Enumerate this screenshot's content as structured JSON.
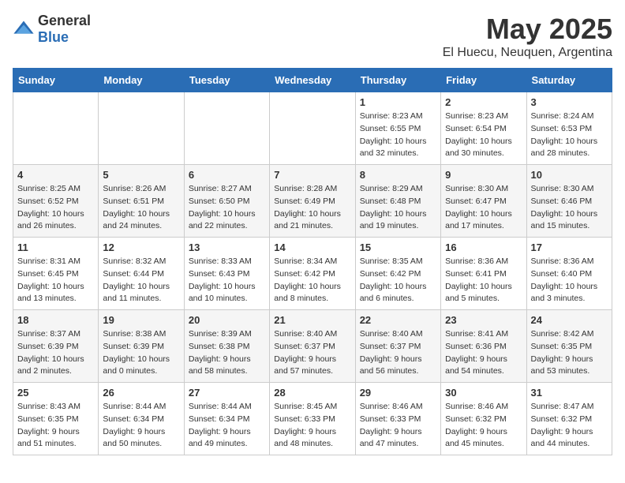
{
  "logo": {
    "text_general": "General",
    "text_blue": "Blue"
  },
  "title": "May 2025",
  "subtitle": "El Huecu, Neuquen, Argentina",
  "days_of_week": [
    "Sunday",
    "Monday",
    "Tuesday",
    "Wednesday",
    "Thursday",
    "Friday",
    "Saturday"
  ],
  "weeks": [
    [
      {
        "day": "",
        "info": ""
      },
      {
        "day": "",
        "info": ""
      },
      {
        "day": "",
        "info": ""
      },
      {
        "day": "",
        "info": ""
      },
      {
        "day": "1",
        "info": "Sunrise: 8:23 AM\nSunset: 6:55 PM\nDaylight: 10 hours\nand 32 minutes."
      },
      {
        "day": "2",
        "info": "Sunrise: 8:23 AM\nSunset: 6:54 PM\nDaylight: 10 hours\nand 30 minutes."
      },
      {
        "day": "3",
        "info": "Sunrise: 8:24 AM\nSunset: 6:53 PM\nDaylight: 10 hours\nand 28 minutes."
      }
    ],
    [
      {
        "day": "4",
        "info": "Sunrise: 8:25 AM\nSunset: 6:52 PM\nDaylight: 10 hours\nand 26 minutes."
      },
      {
        "day": "5",
        "info": "Sunrise: 8:26 AM\nSunset: 6:51 PM\nDaylight: 10 hours\nand 24 minutes."
      },
      {
        "day": "6",
        "info": "Sunrise: 8:27 AM\nSunset: 6:50 PM\nDaylight: 10 hours\nand 22 minutes."
      },
      {
        "day": "7",
        "info": "Sunrise: 8:28 AM\nSunset: 6:49 PM\nDaylight: 10 hours\nand 21 minutes."
      },
      {
        "day": "8",
        "info": "Sunrise: 8:29 AM\nSunset: 6:48 PM\nDaylight: 10 hours\nand 19 minutes."
      },
      {
        "day": "9",
        "info": "Sunrise: 8:30 AM\nSunset: 6:47 PM\nDaylight: 10 hours\nand 17 minutes."
      },
      {
        "day": "10",
        "info": "Sunrise: 8:30 AM\nSunset: 6:46 PM\nDaylight: 10 hours\nand 15 minutes."
      }
    ],
    [
      {
        "day": "11",
        "info": "Sunrise: 8:31 AM\nSunset: 6:45 PM\nDaylight: 10 hours\nand 13 minutes."
      },
      {
        "day": "12",
        "info": "Sunrise: 8:32 AM\nSunset: 6:44 PM\nDaylight: 10 hours\nand 11 minutes."
      },
      {
        "day": "13",
        "info": "Sunrise: 8:33 AM\nSunset: 6:43 PM\nDaylight: 10 hours\nand 10 minutes."
      },
      {
        "day": "14",
        "info": "Sunrise: 8:34 AM\nSunset: 6:42 PM\nDaylight: 10 hours\nand 8 minutes."
      },
      {
        "day": "15",
        "info": "Sunrise: 8:35 AM\nSunset: 6:42 PM\nDaylight: 10 hours\nand 6 minutes."
      },
      {
        "day": "16",
        "info": "Sunrise: 8:36 AM\nSunset: 6:41 PM\nDaylight: 10 hours\nand 5 minutes."
      },
      {
        "day": "17",
        "info": "Sunrise: 8:36 AM\nSunset: 6:40 PM\nDaylight: 10 hours\nand 3 minutes."
      }
    ],
    [
      {
        "day": "18",
        "info": "Sunrise: 8:37 AM\nSunset: 6:39 PM\nDaylight: 10 hours\nand 2 minutes."
      },
      {
        "day": "19",
        "info": "Sunrise: 8:38 AM\nSunset: 6:39 PM\nDaylight: 10 hours\nand 0 minutes."
      },
      {
        "day": "20",
        "info": "Sunrise: 8:39 AM\nSunset: 6:38 PM\nDaylight: 9 hours\nand 58 minutes."
      },
      {
        "day": "21",
        "info": "Sunrise: 8:40 AM\nSunset: 6:37 PM\nDaylight: 9 hours\nand 57 minutes."
      },
      {
        "day": "22",
        "info": "Sunrise: 8:40 AM\nSunset: 6:37 PM\nDaylight: 9 hours\nand 56 minutes."
      },
      {
        "day": "23",
        "info": "Sunrise: 8:41 AM\nSunset: 6:36 PM\nDaylight: 9 hours\nand 54 minutes."
      },
      {
        "day": "24",
        "info": "Sunrise: 8:42 AM\nSunset: 6:35 PM\nDaylight: 9 hours\nand 53 minutes."
      }
    ],
    [
      {
        "day": "25",
        "info": "Sunrise: 8:43 AM\nSunset: 6:35 PM\nDaylight: 9 hours\nand 51 minutes."
      },
      {
        "day": "26",
        "info": "Sunrise: 8:44 AM\nSunset: 6:34 PM\nDaylight: 9 hours\nand 50 minutes."
      },
      {
        "day": "27",
        "info": "Sunrise: 8:44 AM\nSunset: 6:34 PM\nDaylight: 9 hours\nand 49 minutes."
      },
      {
        "day": "28",
        "info": "Sunrise: 8:45 AM\nSunset: 6:33 PM\nDaylight: 9 hours\nand 48 minutes."
      },
      {
        "day": "29",
        "info": "Sunrise: 8:46 AM\nSunset: 6:33 PM\nDaylight: 9 hours\nand 47 minutes."
      },
      {
        "day": "30",
        "info": "Sunrise: 8:46 AM\nSunset: 6:32 PM\nDaylight: 9 hours\nand 45 minutes."
      },
      {
        "day": "31",
        "info": "Sunrise: 8:47 AM\nSunset: 6:32 PM\nDaylight: 9 hours\nand 44 minutes."
      }
    ]
  ]
}
